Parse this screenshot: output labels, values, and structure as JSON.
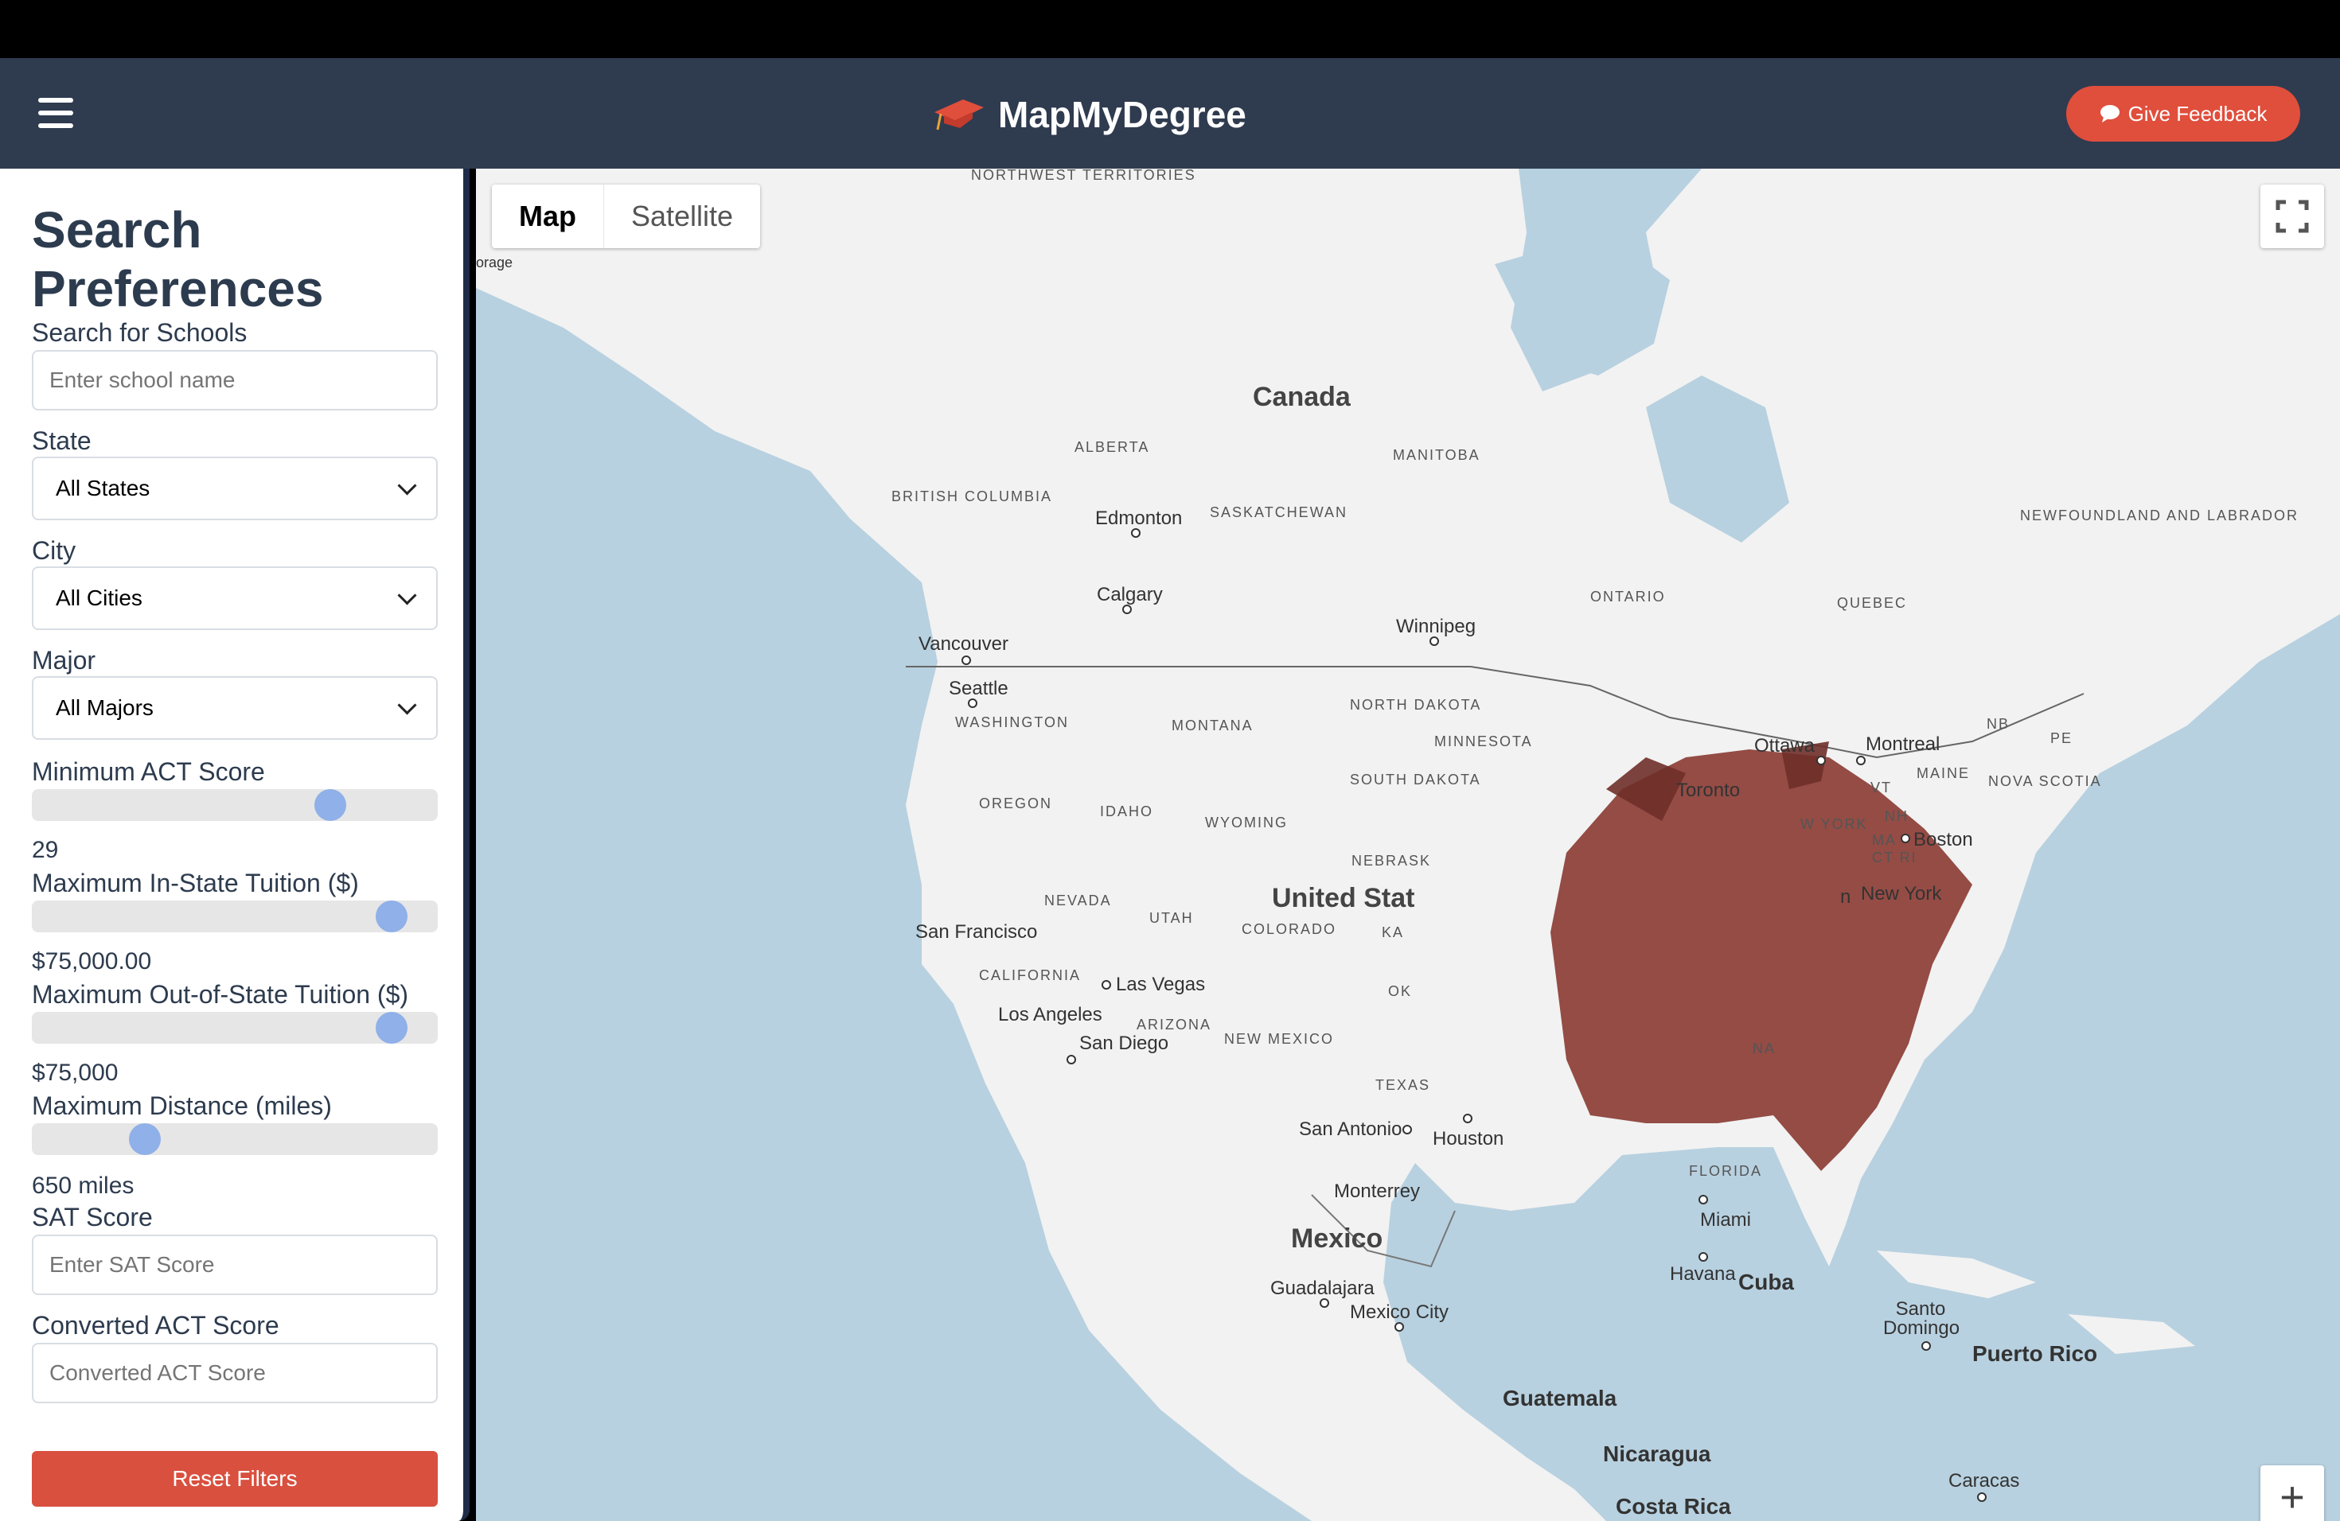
{
  "navbar": {
    "brand": "MapMyDegree",
    "feedback_label": "Give Feedback",
    "menu_icon": "hamburger-menu-icon",
    "logo_icon": "graduation-cap-icon",
    "feedback_icon": "chat-bubble-icon",
    "colors": {
      "navbar": "#2f3b4f",
      "accent": "#e04e3c"
    }
  },
  "sidebar": {
    "title": "Search Preferences",
    "search": {
      "label": "Search for Schools",
      "placeholder": "Enter school name"
    },
    "state": {
      "label": "State",
      "value": "All States"
    },
    "city": {
      "label": "City",
      "value": "All Cities"
    },
    "major": {
      "label": "Major",
      "value": "All Majors"
    },
    "act": {
      "label": "Minimum ACT Score",
      "value": "29",
      "level": 0.755
    },
    "instate": {
      "label": "Maximum In-State Tuition ($)",
      "value": "$75,000.00",
      "level": 0.92
    },
    "outstate": {
      "label": "Maximum Out-of-State Tuition ($)",
      "value": "$75,000",
      "level": 0.92
    },
    "distance": {
      "label": "Maximum Distance (miles)",
      "value": "650 miles",
      "level": 0.26
    },
    "sat": {
      "label": "SAT Score",
      "placeholder": "Enter SAT Score"
    },
    "converted": {
      "label": "Converted ACT Score",
      "placeholder": "Converted ACT Score"
    },
    "reset_label": "Reset Filters"
  },
  "map": {
    "type_map": "Map",
    "type_satellite": "Satellite",
    "fullscreen_icon": "fullscreen-icon",
    "zoom_in_icon": "zoom-in-icon",
    "labels": {
      "nwt": "NORTHWEST TERRITORIES",
      "anchorage": "orage",
      "canada": "Canada",
      "alberta": "ALBERTA",
      "manitoba": "MANITOBA",
      "bc": "BRITISH COLUMBIA",
      "edmonton": "Edmonton",
      "saskatchewan": "SASKATCHEWAN",
      "newfoundland": "NEWFOUNDLAND AND LABRADOR",
      "calgary": "Calgary",
      "ontario": "ONTARIO",
      "quebec": "QUEBEC",
      "winnipeg": "Winnipeg",
      "vancouver": "Vancouver",
      "seattle": "Seattle",
      "washington": "WASHINGTON",
      "montana": "MONTANA",
      "north_dakota": "NORTH DAKOTA",
      "minnesota": "MINNESOTA",
      "ottawa": "Ottawa",
      "montreal": "Montreal",
      "nb": "NB",
      "pe": "PE",
      "maine": "MAINE",
      "nova_scotia": "NOVA SCOTIA",
      "toronto": "Toronto",
      "vt": "VT",
      "new_york_state": "W YORK",
      "nh": "NH",
      "ma": "MA",
      "boston": "Boston",
      "ct_ri": "CT RI",
      "oregon": "OREGON",
      "idaho": "IDAHO",
      "wyoming": "WYOMING",
      "south_dakota": "SOUTH DAKOTA",
      "nebraska": "NEBRASK",
      "new_york": "New York",
      "nevada": "NEVADA",
      "utah": "UTAH",
      "us": "United Stat",
      "colorado": "COLORADO",
      "ka": "KA",
      "jn": "n",
      "san_francisco": "San Francisco",
      "california": "CALIFORNIA",
      "las_vegas": "Las Vegas",
      "ok": "OK",
      "los_angeles": "Los Angeles",
      "arizona": "ARIZONA",
      "nc": "NA",
      "san_diego": "San Diego",
      "new_mexico": "NEW MEXICO",
      "texas": "TEXAS",
      "san_antonio": "San Antonio",
      "houston": "Houston",
      "florida": "FLORIDA",
      "miami": "Miami",
      "monterrey": "Monterrey",
      "mexico": "Mexico",
      "havana": "Havana",
      "cuba": "Cuba",
      "guadalajara": "Guadalajara",
      "mexico_city": "Mexico City",
      "santo_domingo": "Santo Domingo",
      "puerto_rico": "Puerto Rico",
      "guatemala": "Guatemala",
      "nicaragua": "Nicaragua",
      "caracas": "Caracas",
      "costa_rica": "Costa Rica"
    },
    "markers": {
      "icon": "school-marker-icon",
      "color": "#a0453c"
    }
  }
}
